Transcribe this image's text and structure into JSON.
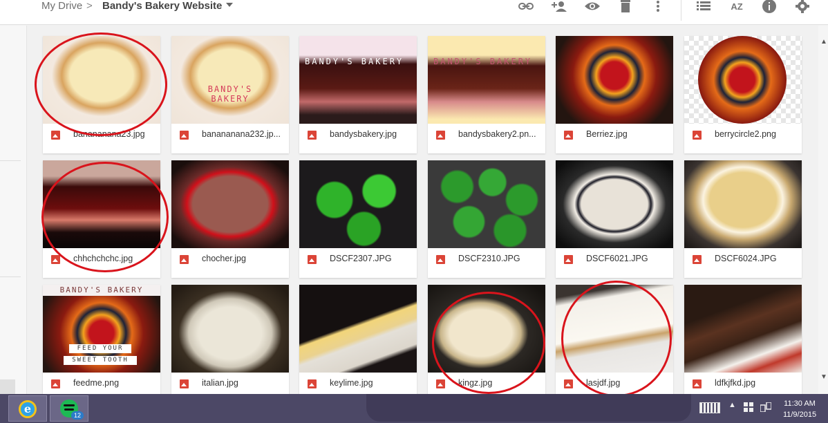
{
  "breadcrumb": {
    "root": "My Drive",
    "separator": ">",
    "current": "Bandy's Bakery Website"
  },
  "toolbar": {
    "icons": [
      "link-icon",
      "share-icon",
      "preview-icon",
      "trash-icon",
      "more-icon",
      "list-view-icon",
      "sort-az-icon",
      "info-icon",
      "settings-icon"
    ],
    "sort_label": "AZ"
  },
  "files": [
    {
      "name": "banananana23.jpg",
      "thumb_overlay": ""
    },
    {
      "name": "banananana232.jp...",
      "thumb_overlay": "BANDY'S BAKERY"
    },
    {
      "name": "bandysbakery.jpg",
      "thumb_overlay": "BANDY'S BAKERY"
    },
    {
      "name": "bandysbakery2.pn...",
      "thumb_overlay": "BANDY'S BAKERY"
    },
    {
      "name": "Berriez.jpg",
      "thumb_overlay": ""
    },
    {
      "name": "berrycircle2.png",
      "thumb_overlay": ""
    },
    {
      "name": "chhchchchc.jpg",
      "thumb_overlay": ""
    },
    {
      "name": "chocher.jpg",
      "thumb_overlay": ""
    },
    {
      "name": "DSCF2307.JPG",
      "thumb_overlay": ""
    },
    {
      "name": "DSCF2310.JPG",
      "thumb_overlay": ""
    },
    {
      "name": "DSCF6021.JPG",
      "thumb_overlay": ""
    },
    {
      "name": "DSCF6024.JPG",
      "thumb_overlay": ""
    },
    {
      "name": "feedme.png",
      "thumb_overlay": "BANDY'S BAKERY",
      "thumb_overlay2": "FEED YOUR",
      "thumb_overlay3": "SWEET TOOTH"
    },
    {
      "name": "italian.jpg",
      "thumb_overlay": ""
    },
    {
      "name": "keylime.jpg",
      "thumb_overlay": ""
    },
    {
      "name": "kingz.jpg",
      "thumb_overlay": ""
    },
    {
      "name": "lasjdf.jpg",
      "thumb_overlay": ""
    },
    {
      "name": "ldfkjfkd.jpg",
      "thumb_overlay": ""
    }
  ],
  "annotations": {
    "circled_files": [
      "banananana23.jpg",
      "chhchchchc.jpg",
      "kingz.jpg",
      "lasjdf.jpg"
    ],
    "circle_color": "#d9141c"
  },
  "taskbar": {
    "apps": [
      "internet-explorer-icon",
      "spotify-icon"
    ],
    "spotify_badge": "12",
    "time": "11:30 AM",
    "date": "11/9/2015"
  },
  "colors": {
    "header_bg": "#ffffff",
    "canvas_bg": "#f1f1f1",
    "file_icon": "#db4437",
    "taskbar_bg": "#4c4866"
  }
}
